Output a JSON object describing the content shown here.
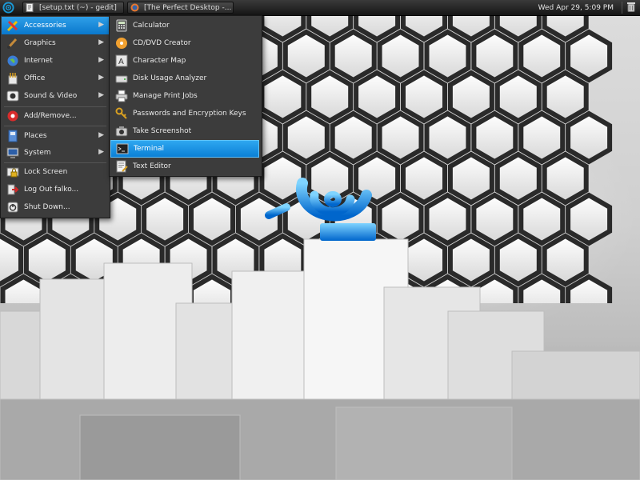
{
  "panel": {
    "tasks": [
      {
        "label": "[setup.txt (~) - gedit]",
        "icon": "gedit-icon"
      },
      {
        "label": "[The Perfect Desktop -...",
        "icon": "firefox-icon"
      }
    ],
    "clock": "Wed Apr 29,  5:09 PM"
  },
  "main_menu": {
    "items": [
      {
        "label": "Accessories",
        "icon": "accessories-icon",
        "submenu": true,
        "active": true
      },
      {
        "label": "Graphics",
        "icon": "graphics-icon",
        "submenu": true
      },
      {
        "label": "Internet",
        "icon": "internet-icon",
        "submenu": true
      },
      {
        "label": "Office",
        "icon": "office-icon",
        "submenu": true
      },
      {
        "label": "Sound & Video",
        "icon": "sound-video-icon",
        "submenu": true
      },
      {
        "label": "Add/Remove...",
        "icon": "add-remove-icon"
      },
      {
        "label": "Places",
        "icon": "places-icon",
        "submenu": true
      },
      {
        "label": "System",
        "icon": "system-icon",
        "submenu": true
      },
      {
        "label": "Lock Screen",
        "icon": "lock-icon"
      },
      {
        "label": "Log Out falko...",
        "icon": "logout-icon"
      },
      {
        "label": "Shut Down...",
        "icon": "shutdown-icon"
      }
    ]
  },
  "accessories_menu": {
    "items": [
      {
        "label": "Calculator",
        "icon": "calculator-icon"
      },
      {
        "label": "CD/DVD Creator",
        "icon": "cd-dvd-icon"
      },
      {
        "label": "Character Map",
        "icon": "character-map-icon"
      },
      {
        "label": "Disk Usage Analyzer",
        "icon": "disk-usage-icon"
      },
      {
        "label": "Manage Print Jobs",
        "icon": "printer-icon"
      },
      {
        "label": "Passwords and Encryption Keys",
        "icon": "keys-icon"
      },
      {
        "label": "Take Screenshot",
        "icon": "camera-icon"
      },
      {
        "label": "Terminal",
        "icon": "terminal-icon",
        "highlighted": true
      },
      {
        "label": "Text Editor",
        "icon": "text-editor-icon"
      }
    ]
  },
  "colors": {
    "highlight": "#0b80d6",
    "menu_bg": "#3c3c3c",
    "panel_bg": "#1e1e1e",
    "logo_blue": "#1a9ad8"
  }
}
